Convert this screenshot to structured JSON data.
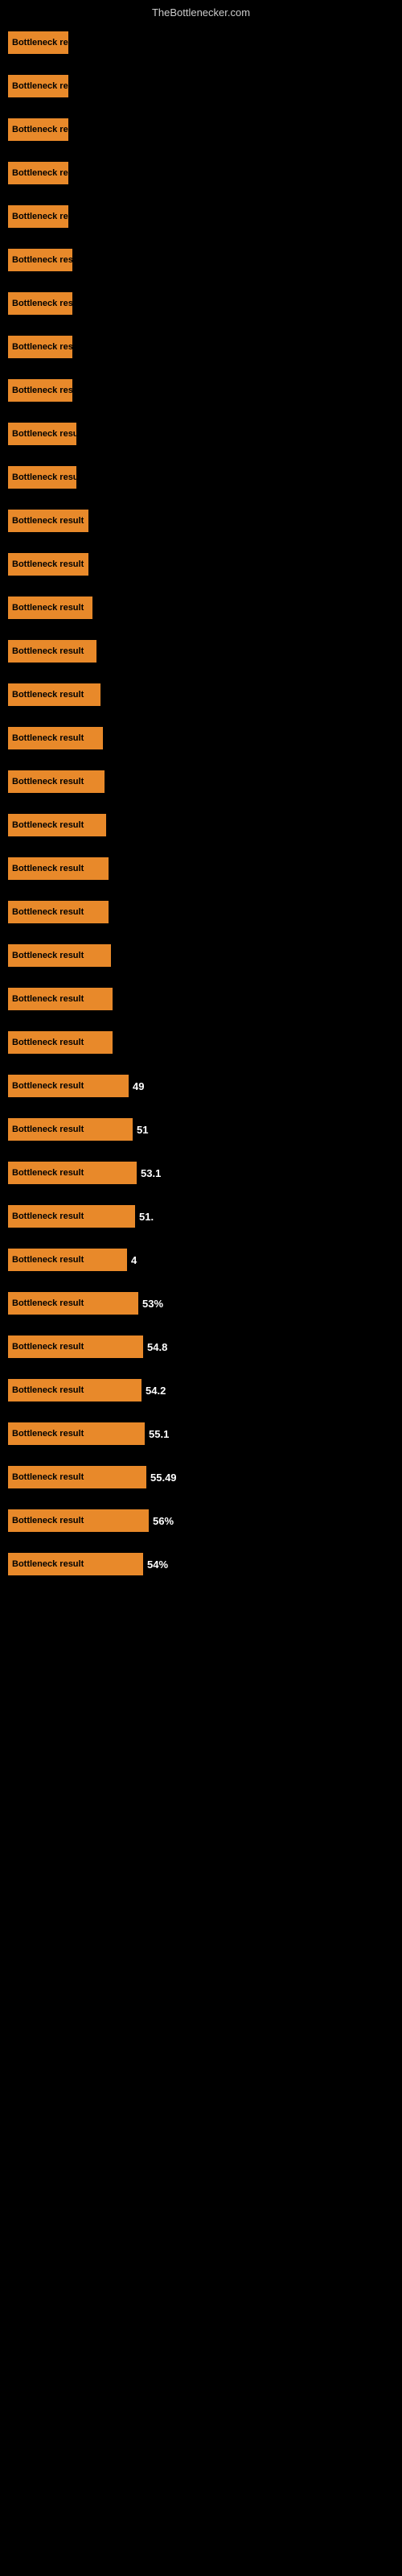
{
  "header": {
    "title": "TheBottlenecker.com"
  },
  "bars": [
    {
      "label": "Bottleneck re",
      "width": 75,
      "value": ""
    },
    {
      "label": "Bottleneck res",
      "width": 75,
      "value": ""
    },
    {
      "label": "Bottleneck res",
      "width": 75,
      "value": ""
    },
    {
      "label": "Bottleneck res",
      "width": 75,
      "value": ""
    },
    {
      "label": "Bottleneck res",
      "width": 75,
      "value": ""
    },
    {
      "label": "Bottleneck resu",
      "width": 80,
      "value": ""
    },
    {
      "label": "Bottleneck res",
      "width": 80,
      "value": ""
    },
    {
      "label": "Bottleneck resu",
      "width": 80,
      "value": ""
    },
    {
      "label": "Bottleneck resu",
      "width": 80,
      "value": ""
    },
    {
      "label": "Bottleneck resu",
      "width": 85,
      "value": ""
    },
    {
      "label": "Bottleneck resu",
      "width": 85,
      "value": ""
    },
    {
      "label": "Bottleneck result",
      "width": 100,
      "value": ""
    },
    {
      "label": "Bottleneck result",
      "width": 100,
      "value": ""
    },
    {
      "label": "Bottleneck result",
      "width": 105,
      "value": ""
    },
    {
      "label": "Bottleneck result",
      "width": 110,
      "value": ""
    },
    {
      "label": "Bottleneck result",
      "width": 115,
      "value": ""
    },
    {
      "label": "Bottleneck result",
      "width": 118,
      "value": ""
    },
    {
      "label": "Bottleneck result",
      "width": 120,
      "value": ""
    },
    {
      "label": "Bottleneck result",
      "width": 122,
      "value": ""
    },
    {
      "label": "Bottleneck result",
      "width": 125,
      "value": ""
    },
    {
      "label": "Bottleneck result",
      "width": 125,
      "value": ""
    },
    {
      "label": "Bottleneck result",
      "width": 128,
      "value": ""
    },
    {
      "label": "Bottleneck result",
      "width": 130,
      "value": ""
    },
    {
      "label": "Bottleneck result",
      "width": 130,
      "value": ""
    },
    {
      "label": "Bottleneck result",
      "width": 150,
      "value": "49"
    },
    {
      "label": "Bottleneck result",
      "width": 155,
      "value": "51"
    },
    {
      "label": "Bottleneck result",
      "width": 160,
      "value": "53.1"
    },
    {
      "label": "Bottleneck result",
      "width": 158,
      "value": "51."
    },
    {
      "label": "Bottleneck result",
      "width": 148,
      "value": "4"
    },
    {
      "label": "Bottleneck result",
      "width": 162,
      "value": "53%"
    },
    {
      "label": "Bottleneck result",
      "width": 168,
      "value": "54.8"
    },
    {
      "label": "Bottleneck result",
      "width": 166,
      "value": "54.2"
    },
    {
      "label": "Bottleneck result",
      "width": 170,
      "value": "55.1"
    },
    {
      "label": "Bottleneck result",
      "width": 172,
      "value": "55.49"
    },
    {
      "label": "Bottleneck result",
      "width": 175,
      "value": "56%"
    },
    {
      "label": "Bottleneck result",
      "width": 168,
      "value": "54%"
    }
  ]
}
